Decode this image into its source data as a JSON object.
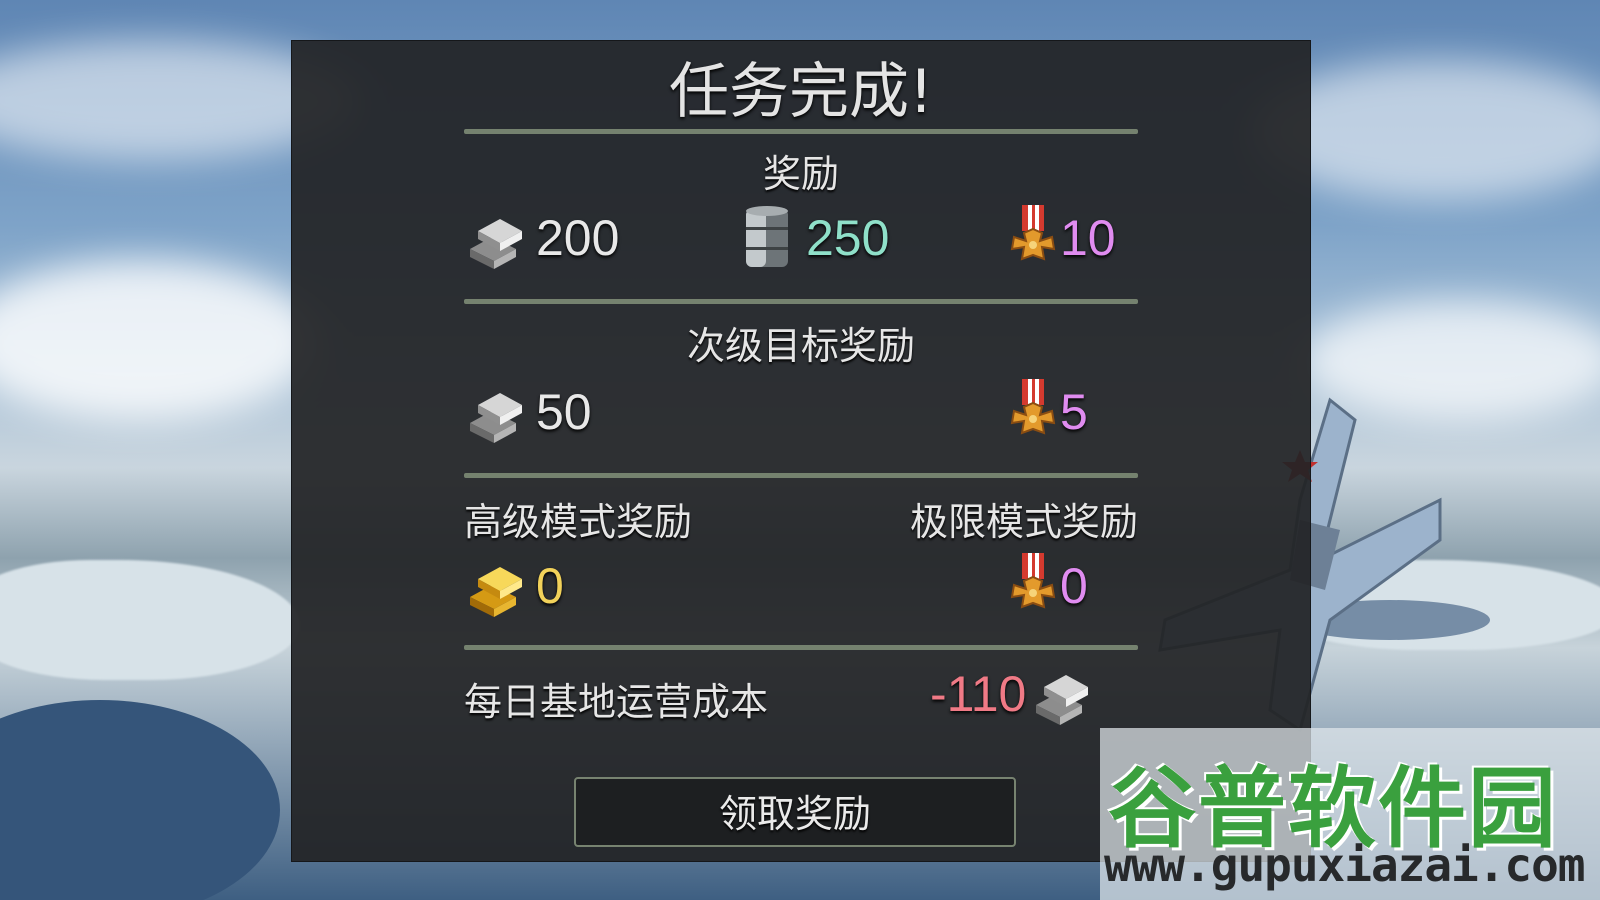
{
  "dialog": {
    "title": "任务完成!",
    "rewards": {
      "heading": "奖励",
      "silver": "200",
      "fuel": "250",
      "medals": "10"
    },
    "secondary": {
      "heading": "次级目标奖励",
      "silver": "50",
      "medals": "5"
    },
    "advanced": {
      "heading": "高级模式奖励",
      "gold": "0"
    },
    "extreme": {
      "heading": "极限模式奖励",
      "medals": "0"
    },
    "daily_cost": {
      "label": "每日基地运营成本",
      "value": "-110"
    },
    "claim_button": "领取奖励"
  },
  "watermark": {
    "title": "谷普软件园",
    "url": "www.gupuxiazai.com"
  },
  "colors": {
    "silver_value": "#e8e8e8",
    "fuel_value": "#8fe0c9",
    "medal_value": "#e08cf0",
    "gold_value": "#f2d25a",
    "cost_value": "#f07a86",
    "divider": "#75826f"
  },
  "icons": [
    "silver-ingot-icon",
    "fuel-barrel-icon",
    "iron-cross-medal-icon",
    "gold-ingot-icon"
  ]
}
